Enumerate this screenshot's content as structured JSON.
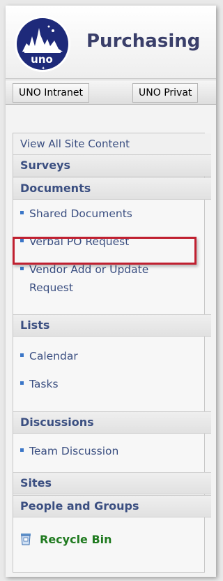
{
  "header": {
    "site_title": "Purchasing",
    "logo_text": "uno"
  },
  "topnav": {
    "tabs": [
      {
        "label": "UNO Intranet"
      },
      {
        "label": "UNO Privat"
      }
    ]
  },
  "quicklaunch": {
    "view_all": "View All Site Content",
    "sections": {
      "surveys": "Surveys",
      "documents": "Documents",
      "lists": "Lists",
      "discussions": "Discussions",
      "sites": "Sites",
      "people": "People and Groups"
    },
    "documents_items": [
      {
        "label": "Shared Documents"
      },
      {
        "label": "Verbal PO Request"
      },
      {
        "label": "Vendor Add or Update Request"
      }
    ],
    "lists_items": [
      {
        "label": "Calendar"
      },
      {
        "label": "Tasks"
      }
    ],
    "discussions_items": [
      {
        "label": "Team Discussion"
      }
    ],
    "recycle_bin": "Recycle Bin"
  },
  "colors": {
    "link": "#3b4f81",
    "bullet": "#3b76c7",
    "highlight": "#c02030",
    "recycle": "#1f7a1f"
  },
  "icons": [
    "uno-logo",
    "bullet-icon",
    "recycle-bin-icon"
  ]
}
